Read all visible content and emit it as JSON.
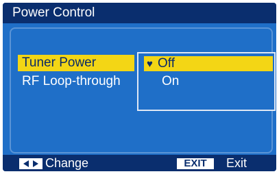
{
  "title": "Power Control",
  "menu": {
    "items": [
      {
        "label": "Tuner Power",
        "selected": true
      },
      {
        "label": "RF Loop-through",
        "selected": false
      }
    ]
  },
  "dropdown": {
    "options": [
      {
        "label": "Off",
        "selected": true
      },
      {
        "label": "On",
        "selected": false
      }
    ],
    "selected_marker_icon": "heart-icon"
  },
  "footer": {
    "change_key_icon": "left-right-arrows-icon",
    "change_label": "Change",
    "exit_key": "EXIT",
    "exit_label": "Exit"
  },
  "colors": {
    "background": "#1f6fc8",
    "title_bar": "#0a2e6e",
    "highlight": "#f3d615",
    "text": "#ffffff"
  }
}
